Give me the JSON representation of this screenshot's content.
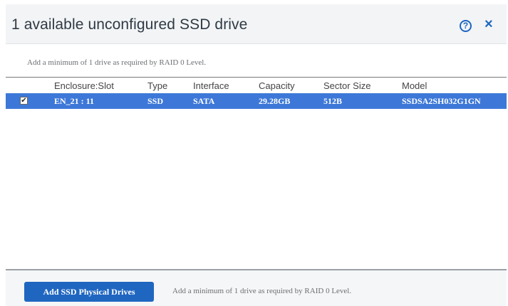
{
  "dialog": {
    "title": "1 available unconfigured SSD drive",
    "help_icon_glyph": "?",
    "close_icon_glyph": "×",
    "hint_top": "Add a minimum of 1 drive as required by RAID 0 Level.",
    "table": {
      "columns": [
        "Enclosure:Slot",
        "Type",
        "Interface",
        "Capacity",
        "Sector Size",
        "Model"
      ],
      "rows": [
        {
          "checked": true,
          "enclosure_slot": "EN_21 : 11",
          "type": "SSD",
          "interface": "SATA",
          "capacity": "29.28GB",
          "sector_size": "512B",
          "model": "SSDSA2SH032G1GN"
        }
      ]
    },
    "footer": {
      "add_button_label": "Add SSD Physical Drives",
      "hint": "Add a minimum of 1 drive as required by RAID 0 Level."
    }
  },
  "colors": {
    "accent": "#1f66c1",
    "selected_row": "#3d78d8",
    "header_bg": "#f2f4f6"
  }
}
